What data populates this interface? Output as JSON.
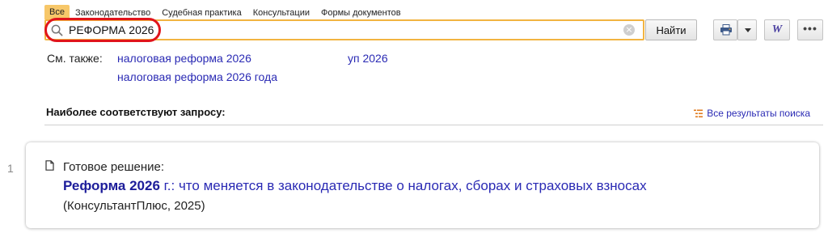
{
  "tabs": [
    {
      "label": "Все",
      "active": true
    },
    {
      "label": "Законодательство",
      "active": false
    },
    {
      "label": "Судебная практика",
      "active": false
    },
    {
      "label": "Консультации",
      "active": false
    },
    {
      "label": "Формы документов",
      "active": false
    }
  ],
  "search": {
    "query": "РЕФОРМА 2026",
    "placeholder": "",
    "find_label": "Найти",
    "clear_icon": "clear-icon",
    "search_icon": "search-icon"
  },
  "toolbar": {
    "print_icon": "printer-icon",
    "dropdown_icon": "chevron-down-icon",
    "word_label": "W",
    "more_label": "•••"
  },
  "see_also": {
    "label": "См. также:",
    "links": [
      "налоговая реформа 2026",
      "налоговая реформа 2026 года",
      "уп 2026"
    ]
  },
  "results_section": {
    "title": "Наиболее соответствуют запросу:",
    "all_results_label": "Все результаты поиска"
  },
  "results": [
    {
      "index": "1",
      "kind": "Готовое решение:",
      "title_highlight": "Реформа 2026",
      "title_rest": " г.: что меняется в законодательстве о налогах, сборах и страховых взносах",
      "source": "(КонсультантПлюс, 2025)"
    }
  ],
  "colors": {
    "accent": "#f2b441",
    "tab_active": "#f7c769",
    "link": "#2a2ab4",
    "highlight_ring": "#e0141b"
  }
}
